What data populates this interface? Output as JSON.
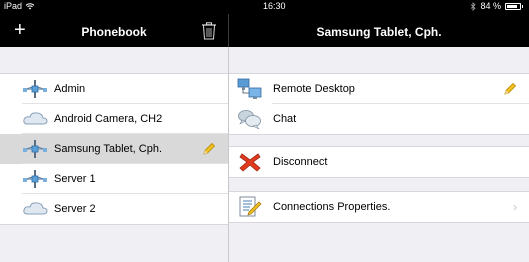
{
  "status": {
    "device": "iPad",
    "time": "16:30",
    "battery": "84 %"
  },
  "nav": {
    "left_title": "Phonebook",
    "right_title": "Samsung Tablet, Cph."
  },
  "phonebook": {
    "items": [
      {
        "label": "Admin",
        "icon": "network-connector-icon"
      },
      {
        "label": "Android Camera, CH2",
        "icon": "cloud-icon"
      },
      {
        "label": "Samsung Tablet, Cph.",
        "icon": "network-connector-icon",
        "selected": true
      },
      {
        "label": "Server 1",
        "icon": "network-connector-icon"
      },
      {
        "label": "Server 2",
        "icon": "cloud-icon"
      }
    ]
  },
  "actions": {
    "remote_desktop": "Remote Desktop",
    "chat": "Chat",
    "disconnect": "Disconnect",
    "connection_properties": "Connections Properties."
  },
  "colors": {
    "bar": "#000000",
    "selected_row": "#d9d9d9",
    "pencil": "#f0c020",
    "disconnect": "#e03b1f"
  }
}
